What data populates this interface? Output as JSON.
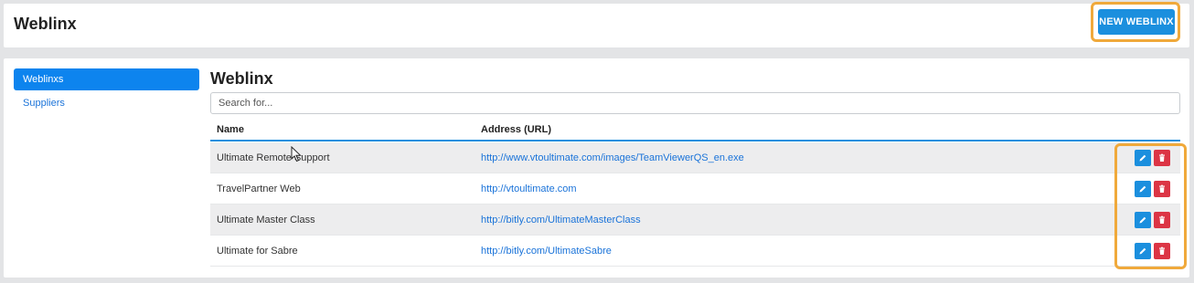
{
  "header": {
    "title": "Weblinx",
    "new_button_label": "NEW WEBLINX"
  },
  "sidebar": {
    "items": [
      {
        "label": "Weblinxs",
        "active": true
      },
      {
        "label": "Suppliers",
        "active": false
      }
    ]
  },
  "main": {
    "title": "Weblinx",
    "search_placeholder": "Search for...",
    "columns": [
      "Name",
      "Address (URL)"
    ],
    "rows": [
      {
        "name": "Ultimate Remote Support",
        "url": "http://www.vtoultimate.com/images/TeamViewerQS_en.exe"
      },
      {
        "name": "TravelPartner Web",
        "url": "http://vtoultimate.com"
      },
      {
        "name": "Ultimate Master Class",
        "url": "http://bitly.com/UltimateMasterClass"
      },
      {
        "name": "Ultimate for Sabre",
        "url": "http://bitly.com/UltimateSabre"
      }
    ],
    "row_actions": {
      "edit_icon": "pencil-icon",
      "delete_icon": "trash-icon"
    }
  },
  "colors": {
    "primary": "#1b8fde",
    "sidebar_active": "#0d84ee",
    "danger": "#dc3545",
    "highlight": "#f0a93b",
    "link": "#1a73d9"
  }
}
